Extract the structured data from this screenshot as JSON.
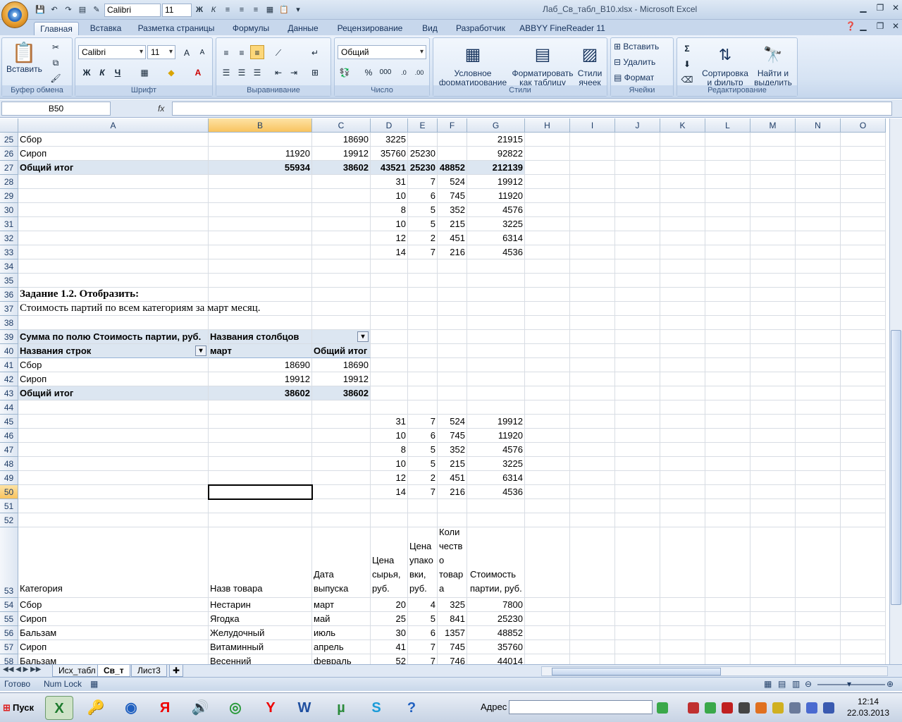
{
  "window": {
    "title": "Лаб_Св_табл_B10.xlsx - Microsoft Excel"
  },
  "qat": {
    "font": "Calibri",
    "size": "11"
  },
  "tabs": [
    "Главная",
    "Вставка",
    "Разметка страницы",
    "Формулы",
    "Данные",
    "Рецензирование",
    "Вид",
    "Разработчик",
    "ABBYY FineReader 11"
  ],
  "ribbon": {
    "clipboard": {
      "label": "Буфер обмена",
      "paste": "Вставить"
    },
    "font": {
      "label": "Шрифт",
      "name": "Calibri",
      "size": "11",
      "bold": "Ж",
      "italic": "К",
      "underline": "Ч"
    },
    "alignment": {
      "label": "Выравнивание"
    },
    "number": {
      "label": "Число",
      "format": "Общий",
      "percent": "%",
      "thousands": "000"
    },
    "styles": {
      "label": "Стили",
      "cond_format": "Условное форматирование",
      "format_table": "Форматировать как таблицу",
      "cell_styles": "Стили ячеек"
    },
    "cells": {
      "label": "Ячейки",
      "insert": "Вставить",
      "delete": "Удалить",
      "format": "Формат"
    },
    "editing": {
      "label": "Редактирование",
      "sort": "Сортировка и фильтр",
      "find": "Найти и выделить"
    }
  },
  "formula_bar": {
    "name_box": "B50",
    "fx": "fx",
    "value": ""
  },
  "columns": [
    "A",
    "B",
    "C",
    "D",
    "E",
    "F",
    "G",
    "H",
    "I",
    "J",
    "K",
    "L",
    "M",
    "N",
    "O"
  ],
  "rows": {
    "r25": {
      "n": "25",
      "A": "Сбор",
      "C": "18690",
      "D": "3225",
      "G": "21915"
    },
    "r26": {
      "n": "26",
      "A": "Сироп",
      "B": "11920",
      "C": "19912",
      "D": "35760",
      "E": "25230",
      "G": "92822"
    },
    "r27": {
      "n": "27",
      "A": "Общий итог",
      "B": "55934",
      "C": "38602",
      "D": "43521",
      "E": "25230",
      "F": "48852",
      "G": "212139"
    },
    "r28": {
      "n": "28",
      "D": "31",
      "E": "7",
      "F": "524",
      "G": "19912"
    },
    "r29": {
      "n": "29",
      "D": "10",
      "E": "6",
      "F": "745",
      "G": "11920"
    },
    "r30": {
      "n": "30",
      "D": "8",
      "E": "5",
      "F": "352",
      "G": "4576"
    },
    "r31": {
      "n": "31",
      "D": "10",
      "E": "5",
      "F": "215",
      "G": "3225"
    },
    "r32": {
      "n": "32",
      "D": "12",
      "E": "2",
      "F": "451",
      "G": "6314"
    },
    "r33": {
      "n": "33",
      "D": "14",
      "E": "7",
      "F": "216",
      "G": "4536"
    },
    "r34": {
      "n": "34"
    },
    "r35": {
      "n": "35"
    },
    "r36": {
      "n": "36",
      "A": "Задание 1.2. Отобразить:"
    },
    "r37": {
      "n": "37",
      "A": "Стоимость партий по всем категориям за март месяц."
    },
    "r38": {
      "n": "38"
    },
    "r39": {
      "n": "39",
      "A": "Сумма по полю  Стоимость партии, руб.",
      "B": "Названия столбцов"
    },
    "r40": {
      "n": "40",
      "A": "Названия строк",
      "B": "март",
      "C": "Общий итог"
    },
    "r41": {
      "n": "41",
      "A": "Сбор",
      "B": "18690",
      "C": "18690"
    },
    "r42": {
      "n": "42",
      "A": "Сироп",
      "B": "19912",
      "C": "19912"
    },
    "r43": {
      "n": "43",
      "A": "Общий итог",
      "B": "38602",
      "C": "38602"
    },
    "r44": {
      "n": "44"
    },
    "r45": {
      "n": "45",
      "D": "31",
      "E": "7",
      "F": "524",
      "G": "19912"
    },
    "r46": {
      "n": "46",
      "D": "10",
      "E": "6",
      "F": "745",
      "G": "11920"
    },
    "r47": {
      "n": "47",
      "D": "8",
      "E": "5",
      "F": "352",
      "G": "4576"
    },
    "r48": {
      "n": "48",
      "D": "10",
      "E": "5",
      "F": "215",
      "G": "3225"
    },
    "r49": {
      "n": "49",
      "D": "12",
      "E": "2",
      "F": "451",
      "G": "6314"
    },
    "r50": {
      "n": "50",
      "D": "14",
      "E": "7",
      "F": "216",
      "G": "4536"
    },
    "r51": {
      "n": "51"
    },
    "r52": {
      "n": "52"
    },
    "r53": {
      "n": "53",
      "A": "Категория",
      "B": "Назв товара",
      "C": "Дата выпуска",
      "D": "Цена сырья, руб.",
      "E": "Цена упако вки, руб.",
      "F": "Коли честв о товар а",
      "G": "Стоимость партии, руб."
    },
    "r54": {
      "n": "54",
      "A": "Сбор",
      "B": "Нестарин",
      "C": "март",
      "D": "20",
      "E": "4",
      "F": "325",
      "G": "7800"
    },
    "r55": {
      "n": "55",
      "A": "Сироп",
      "B": "Ягодка",
      "C": "май",
      "D": "25",
      "E": "5",
      "F": "841",
      "G": "25230"
    },
    "r56": {
      "n": "56",
      "A": "Бальзам",
      "B": "Желудочный",
      "C": "июль",
      "D": "30",
      "E": "6",
      "F": "1357",
      "G": "48852"
    },
    "r57": {
      "n": "57",
      "A": "Сироп",
      "B": "Витаминный",
      "C": "апрель",
      "D": "41",
      "E": "7",
      "F": "745",
      "G": "35760"
    },
    "r58": {
      "n": "58",
      "A": "Бальзам",
      "B": "Весенний",
      "C": "февраль",
      "D": "52",
      "E": "7",
      "F": "746",
      "G": "44014"
    }
  },
  "sheets": [
    "Исх_табл",
    "Св_т",
    "Лист3"
  ],
  "status": {
    "ready": "Готово",
    "numlock": "Num Lock"
  },
  "taskbar": {
    "start": "Пуск",
    "address": "Адрес",
    "time": "12:14",
    "date": "22.03.2013"
  }
}
